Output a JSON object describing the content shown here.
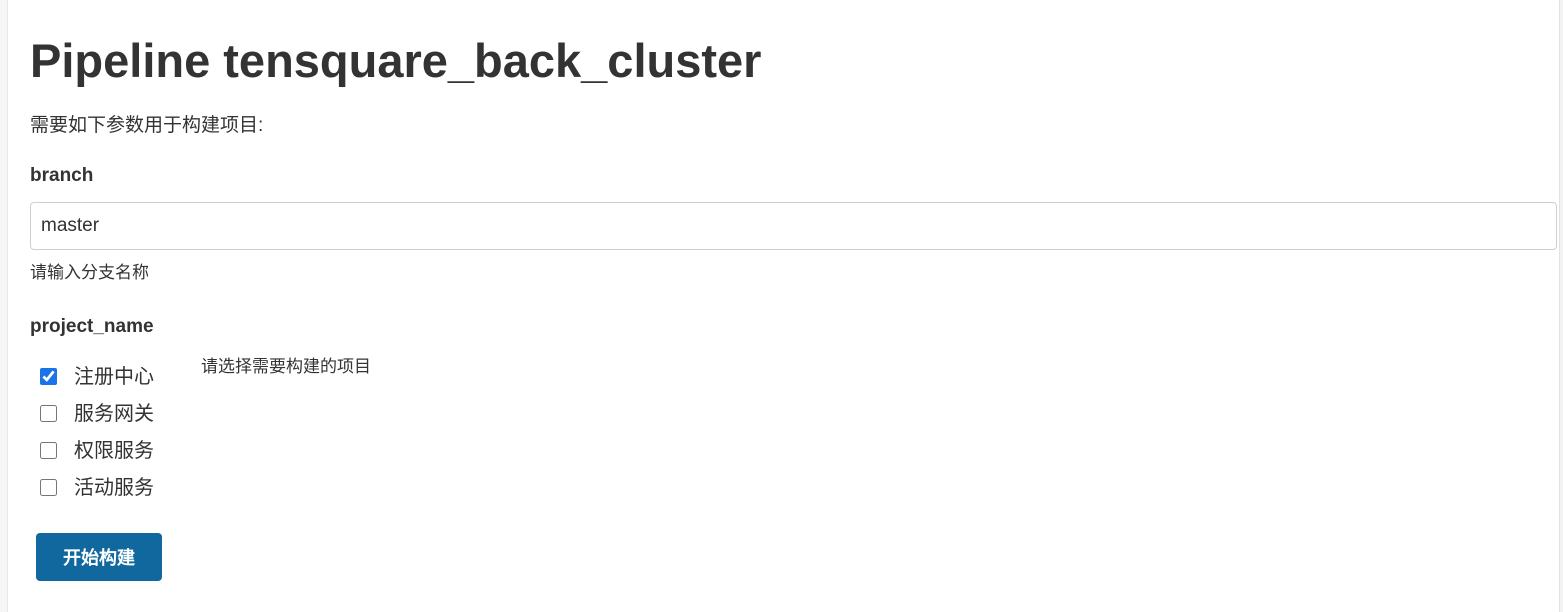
{
  "page": {
    "title": "Pipeline tensquare_back_cluster",
    "intro": "需要如下参数用于构建项目:"
  },
  "parameters": {
    "branch": {
      "name": "branch",
      "value": "master",
      "description": "请输入分支名称"
    },
    "project_name": {
      "name": "project_name",
      "description": "请选择需要构建的项目",
      "options": [
        {
          "label": "注册中心",
          "checked": true
        },
        {
          "label": "服务网关",
          "checked": false
        },
        {
          "label": "权限服务",
          "checked": false
        },
        {
          "label": "活动服务",
          "checked": false
        }
      ]
    }
  },
  "actions": {
    "build_label": "开始构建"
  },
  "colors": {
    "primary_button": "#11689f",
    "checkbox_accent": "#1a73e8",
    "text": "#333333"
  }
}
